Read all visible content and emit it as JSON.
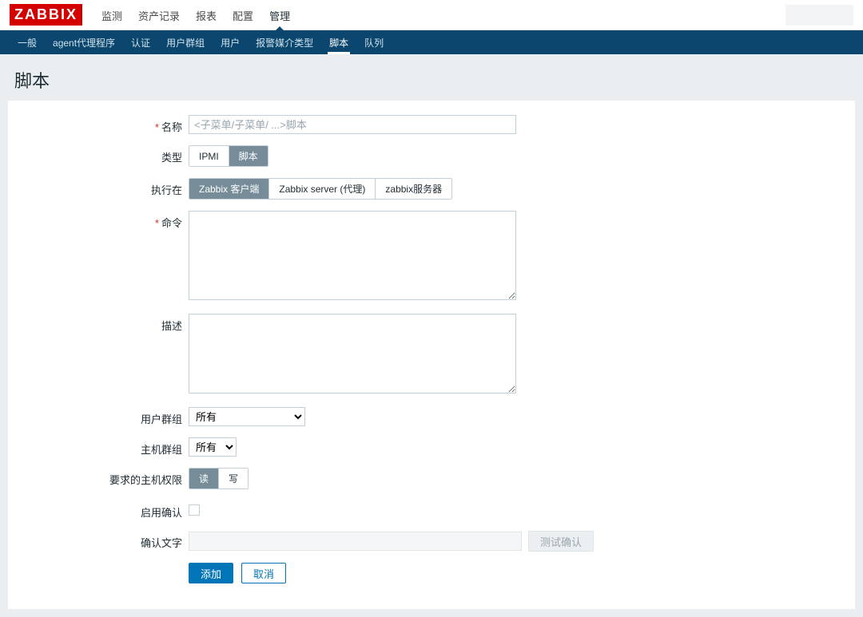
{
  "logo": "ZABBIX",
  "top_menu": {
    "items": [
      {
        "label": "监测"
      },
      {
        "label": "资产记录"
      },
      {
        "label": "报表"
      },
      {
        "label": "配置"
      },
      {
        "label": "管理",
        "active": true
      }
    ]
  },
  "sub_menu": {
    "items": [
      {
        "label": "一般"
      },
      {
        "label": "agent代理程序"
      },
      {
        "label": "认证"
      },
      {
        "label": "用户群组"
      },
      {
        "label": "用户"
      },
      {
        "label": "报警媒介类型"
      },
      {
        "label": "脚本",
        "active": true
      },
      {
        "label": "队列"
      }
    ]
  },
  "page_title": "脚本",
  "form": {
    "name": {
      "label": "名称",
      "placeholder": "<子菜单/子菜单/ ...>脚本",
      "value": ""
    },
    "type": {
      "label": "类型",
      "options": [
        "IPMI",
        "脚本"
      ],
      "selected": "脚本"
    },
    "execute_on": {
      "label": "执行在",
      "options": [
        "Zabbix 客户端",
        "Zabbix server (代理)",
        "zabbix服务器"
      ],
      "selected": "Zabbix 客户端"
    },
    "command": {
      "label": "命令",
      "value": ""
    },
    "description": {
      "label": "描述",
      "value": ""
    },
    "user_group": {
      "label": "用户群组",
      "options": [
        "所有"
      ],
      "value": "所有"
    },
    "host_group": {
      "label": "主机群组",
      "options": [
        "所有"
      ],
      "value": "所有"
    },
    "host_perm": {
      "label": "要求的主机权限",
      "options": [
        "读",
        "写"
      ],
      "selected": "读"
    },
    "enable_confirm": {
      "label": "启用确认",
      "checked": false
    },
    "confirm_text": {
      "label": "确认文字",
      "value": "",
      "test_btn": "测试确认"
    },
    "buttons": {
      "submit": "添加",
      "cancel": "取消"
    }
  }
}
